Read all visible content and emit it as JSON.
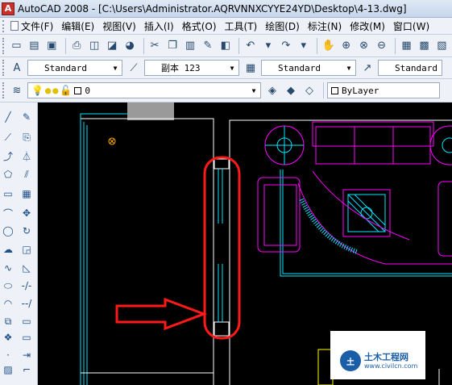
{
  "window": {
    "title": "AutoCAD 2008 - [C:\\Users\\Administrator.AQRVNNXCYYE24YD\\Desktop\\4-13.dwg]"
  },
  "menu": {
    "items": [
      {
        "label": "文件(F)"
      },
      {
        "label": "编辑(E)"
      },
      {
        "label": "视图(V)"
      },
      {
        "label": "插入(I)"
      },
      {
        "label": "格式(O)"
      },
      {
        "label": "工具(T)"
      },
      {
        "label": "绘图(D)"
      },
      {
        "label": "标注(N)"
      },
      {
        "label": "修改(M)"
      },
      {
        "label": "窗口(W)"
      }
    ]
  },
  "styles_toolbar": {
    "text_style": "Standard",
    "dim_style": "副本 123",
    "table_style": "Standard",
    "multileader_style": "Standard"
  },
  "layers_toolbar": {
    "current_layer": "0",
    "linetype": "ByLayer"
  },
  "watermark": {
    "title": "土木工程网",
    "url": "www.civilcn.com"
  },
  "colors": {
    "wall": "#ffffff",
    "door_window": "#00e5ff",
    "furniture": "#ff00ff",
    "annotation_red": "#ff1a1a"
  }
}
